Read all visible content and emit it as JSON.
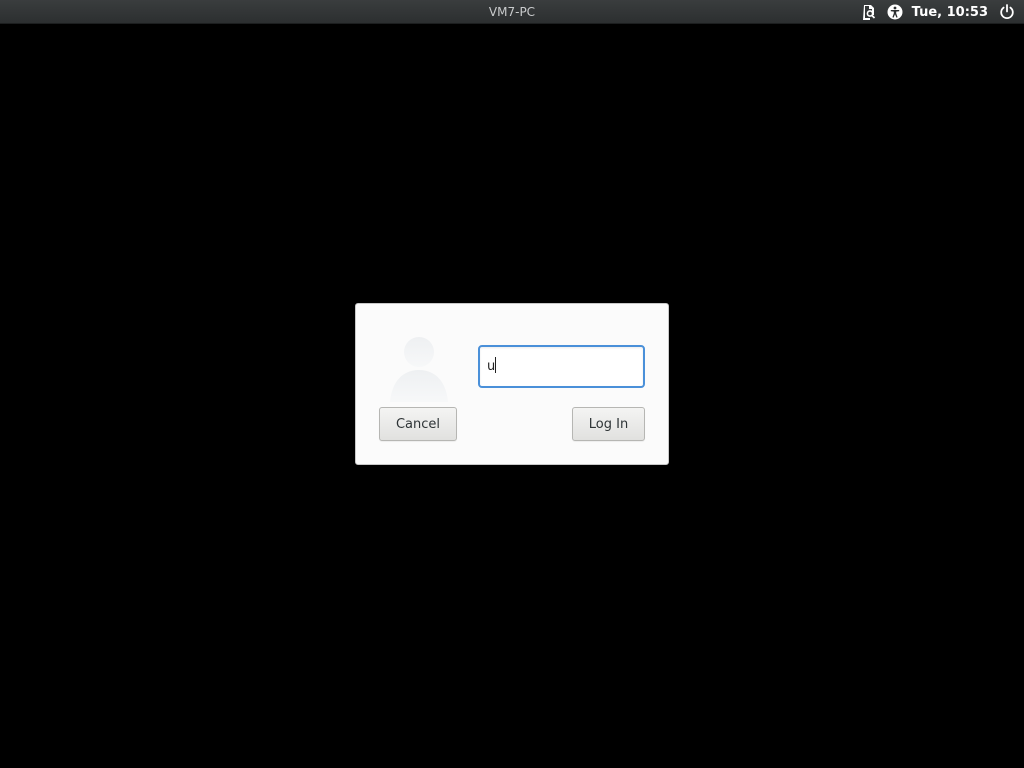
{
  "topbar": {
    "host_name": "VM7-PC",
    "clock": "Tue, 10:53",
    "icons": [
      "document-search-icon",
      "accessibility-icon",
      "power-icon"
    ]
  },
  "login_dialog": {
    "avatar_icon": "user-avatar-icon",
    "password_field": {
      "value": "u"
    },
    "cancel_label": "Cancel",
    "login_label": "Log In"
  },
  "colors": {
    "background": "#000000",
    "topbar": "#2c2f30",
    "dialog": "#fbfbfb",
    "focus_ring": "#4a90d9"
  }
}
